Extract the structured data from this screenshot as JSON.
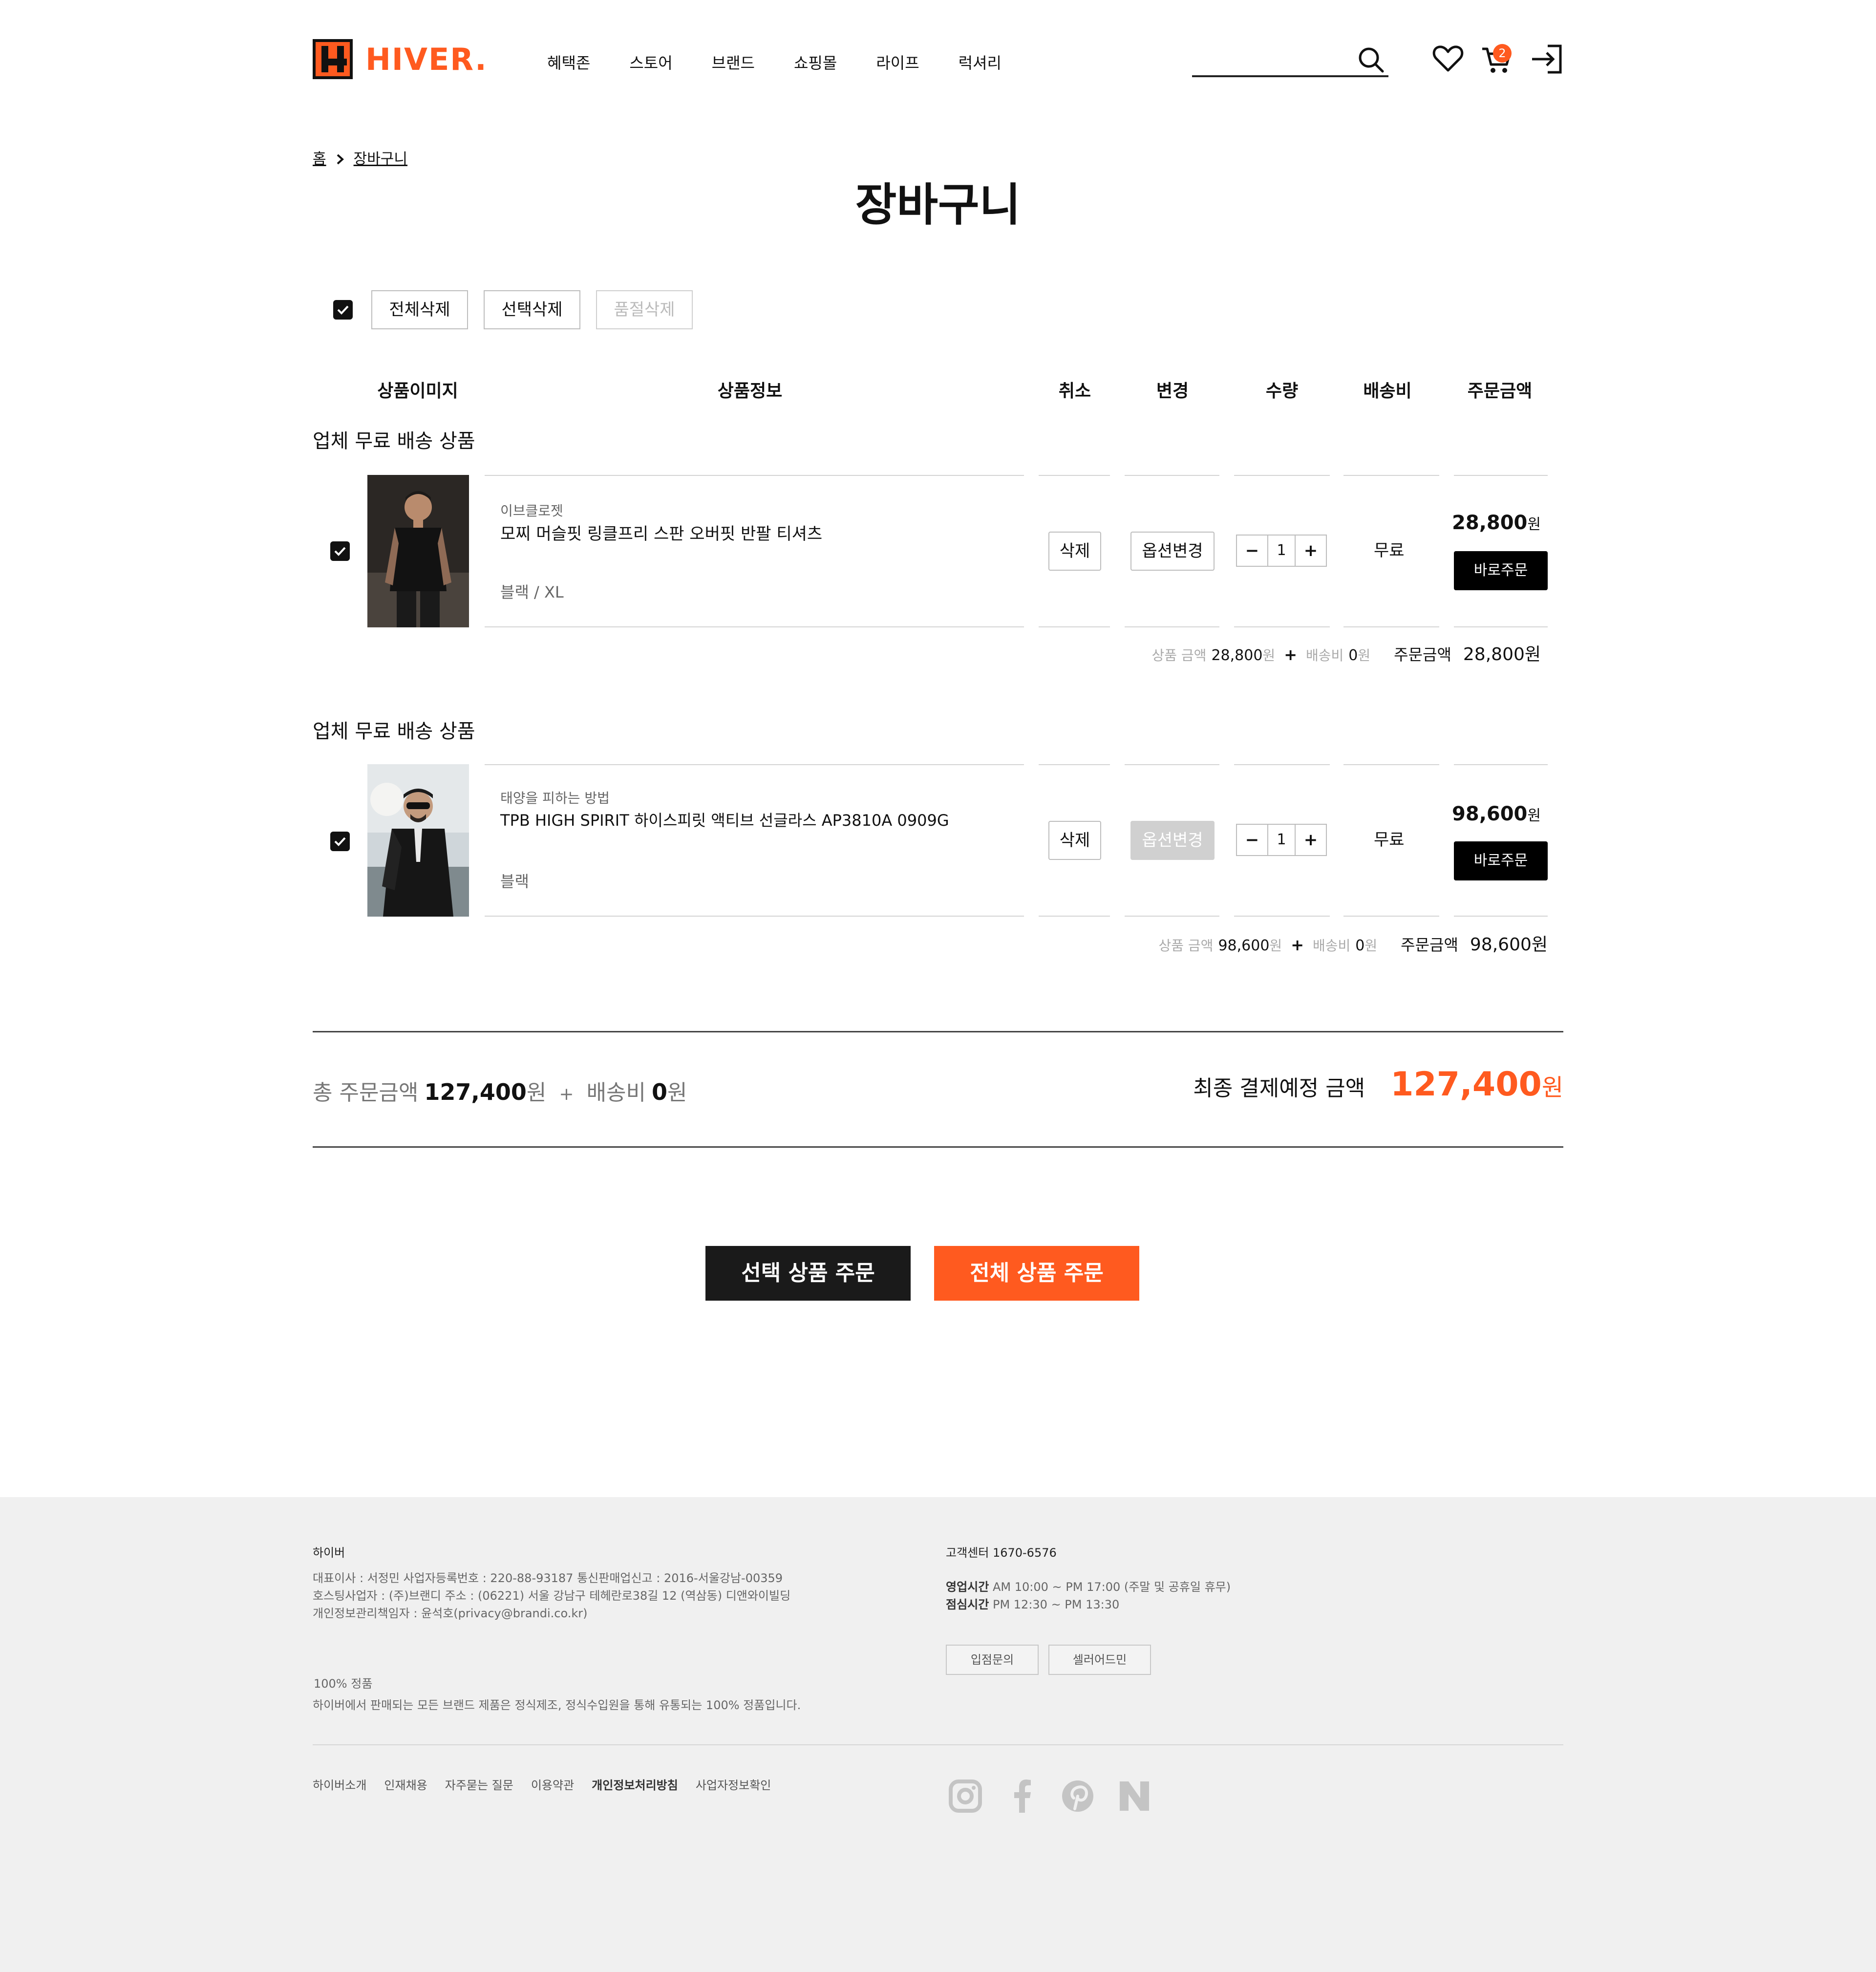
{
  "header": {
    "logo_text": "HIVER.",
    "nav": [
      "혜택존",
      "스토어",
      "브랜드",
      "쇼핑몰",
      "라이프",
      "럭셔리"
    ],
    "cart_count": "2"
  },
  "breadcrumb": {
    "home": "홈",
    "current": "장바구니"
  },
  "page_title": "장바구니",
  "controls": {
    "delete_all": "전체삭제",
    "delete_selected": "선택삭제",
    "delete_soldout": "품절삭제"
  },
  "table_headers": [
    "상품이미지",
    "상품정보",
    "취소",
    "변경",
    "수량",
    "배송비",
    "주문금액"
  ],
  "groups": [
    {
      "title": "업체 무료 배송 상품",
      "item": {
        "brand": "이브클로젯",
        "name": "모찌 머슬핏 링클프리 스판 오버핏 반팔 티셔츠",
        "option": "블랙 / XL",
        "delete_label": "삭제",
        "change_label": "옵션변경",
        "qty": "1",
        "shipping": "무료",
        "price": "28,800",
        "won": "원",
        "buy_now": "바로주문"
      },
      "subtotal": {
        "goods_label": "상품 금액",
        "goods_amount": "28,800",
        "won": "원",
        "ship_label": "배송비",
        "ship_amount": "0",
        "order_label": "주문금액",
        "order_amount": "28,800원"
      }
    },
    {
      "title": "업체 무료 배송 상품",
      "item": {
        "brand": "태양을 피하는 방법",
        "name": "TPB HIGH SPIRIT 하이스피릿 액티브 선글라스 AP3810A 0909G",
        "option": "블랙",
        "delete_label": "삭제",
        "change_label": "옵션변경",
        "qty": "1",
        "shipping": "무료",
        "price": "98,600",
        "won": "원",
        "buy_now": "바로주문"
      },
      "subtotal": {
        "goods_label": "상품 금액",
        "goods_amount": "98,600",
        "won": "원",
        "ship_label": "배송비",
        "ship_amount": "0",
        "order_label": "주문금액",
        "order_amount": "98,600원"
      }
    }
  ],
  "totals": {
    "total_label": "총 주문금액",
    "total_amount": "127,400",
    "won": "원",
    "plus": "+",
    "ship_label": "배송비",
    "ship_amount": "0",
    "final_label": "최종 결제예정 금액",
    "final_amount": "127,400"
  },
  "actions": {
    "order_selected": "선택 상품 주문",
    "order_all": "전체 상품 주문"
  },
  "footer": {
    "company": "하이버",
    "line1": "대표이사 : 서정민 사업자등록번호 : 220-88-93187 통신판매업신고 : 2016-서울강남-00359",
    "line2": "호스팅사업자 : (주)브랜디 주소 : (06221) 서울 강남구 테헤란로38길 12 (역삼동) 디앤와이빌딩",
    "line3": "개인정보관리책임자 : 윤석호(privacy@brandi.co.kr)",
    "genuine_title": "100% 정품",
    "genuine_text": "하이버에서 판매되는 모든 브랜드 제품은 정식제조, 정식수입원을 통해 유통되는 100% 정품입니다.",
    "cs_title": "고객센터 1670-6576",
    "hours_label": "영업시간",
    "hours_value": "AM 10:00 ~ PM 17:00 (주말 및 공휴일 휴무)",
    "lunch_label": "점심시간",
    "lunch_value": "PM 12:30 ~ PM 13:30",
    "btn_partner": "입점문의",
    "btn_seller": "셀러어드민",
    "links": [
      "하이버소개",
      "인재채용",
      "자주묻는 질문",
      "이용약관",
      "개인정보처리방침",
      "사업자정보확인"
    ]
  },
  "colors": {
    "accent": "#ff5a1f",
    "dark": "#111111"
  }
}
